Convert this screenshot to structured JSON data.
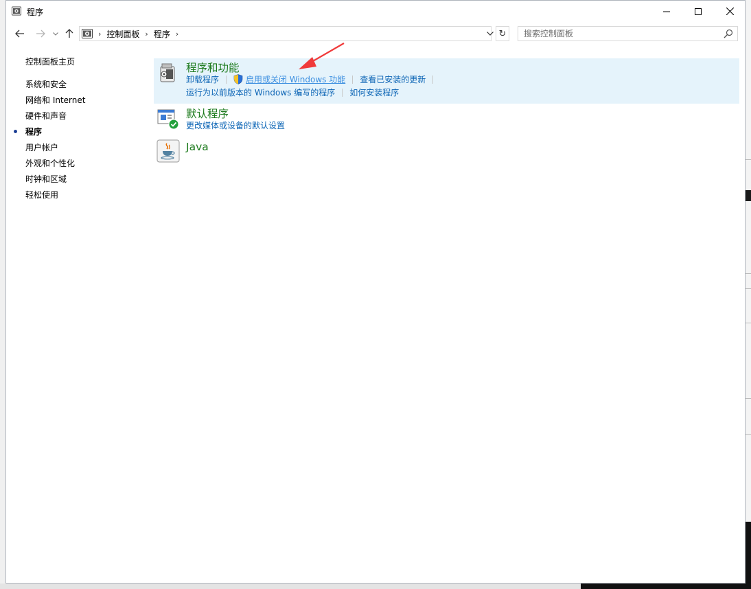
{
  "window": {
    "title": "程序",
    "controls": {
      "minimize": "minimize",
      "maximize": "maximize",
      "close": "close"
    }
  },
  "nav": {
    "back": "←",
    "forward": "→",
    "recent": "⌄",
    "up": "↑",
    "breadcrumb": [
      "控制面板",
      "程序"
    ],
    "refresh": "↻",
    "search_placeholder": "搜索控制面板"
  },
  "sidebar": {
    "home": "控制面板主页",
    "items": [
      {
        "label": "系统和安全",
        "active": false
      },
      {
        "label": "网络和 Internet",
        "active": false
      },
      {
        "label": "硬件和声音",
        "active": false
      },
      {
        "label": "程序",
        "active": true
      },
      {
        "label": "用户帐户",
        "active": false
      },
      {
        "label": "外观和个性化",
        "active": false
      },
      {
        "label": "时钟和区域",
        "active": false
      },
      {
        "label": "轻松使用",
        "active": false
      }
    ]
  },
  "categories": [
    {
      "title": "程序和功能",
      "icon": "programs-features-icon",
      "links_row1": [
        "卸载程序",
        "启用或关闭 Windows 功能",
        "查看已安装的更新"
      ],
      "links_row2": [
        "运行为以前版本的 Windows 编写的程序",
        "如何安装程序"
      ]
    },
    {
      "title": "默认程序",
      "icon": "default-programs-icon",
      "links_row1": [
        "更改媒体或设备的默认设置"
      ]
    },
    {
      "title": "Java",
      "icon": "java-icon"
    }
  ],
  "colors": {
    "category_title": "#1e7b1e",
    "link": "#0e66b6",
    "highlight_bg": "#e5f3fb",
    "annotation_arrow": "#f03a3a"
  }
}
